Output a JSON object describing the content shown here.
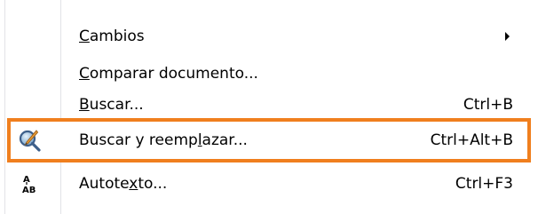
{
  "menu": {
    "items": [
      {
        "label_pre": "",
        "label_key": "C",
        "label_post": "ambios",
        "shortcut": "",
        "has_submenu": true,
        "icon": ""
      },
      {
        "label_pre": "",
        "label_key": "C",
        "label_post": "omparar documento...",
        "shortcut": "",
        "has_submenu": false,
        "icon": ""
      },
      {
        "label_pre": "",
        "label_key": "B",
        "label_post": "uscar...",
        "shortcut": "Ctrl+B",
        "has_submenu": false,
        "icon": ""
      },
      {
        "label_pre": "Buscar y reemp",
        "label_key": "l",
        "label_post": "azar...",
        "shortcut": "Ctrl+Alt+B",
        "has_submenu": false,
        "icon": "find-replace-icon"
      },
      {
        "label_pre": "Autote",
        "label_key": "x",
        "label_post": "to...",
        "shortcut": "Ctrl+F3",
        "has_submenu": false,
        "icon": "autotext-icon"
      }
    ],
    "highlight_color": "#f07f1e"
  }
}
